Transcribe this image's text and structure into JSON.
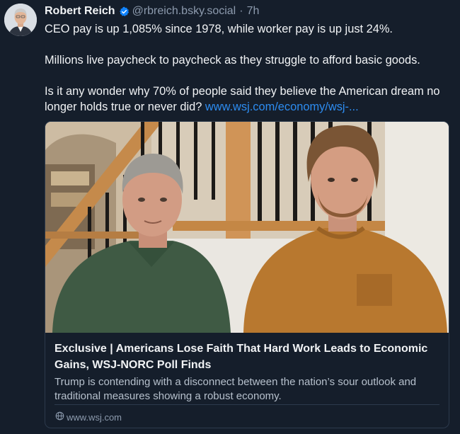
{
  "author": {
    "display_name": "Robert Reich",
    "handle": "@rbreich.bsky.social",
    "separator": "·",
    "time": "7h",
    "verified": true
  },
  "post": {
    "paragraph_1": "CEO pay is up 1,085% since 1978, while worker pay is up just 24%.",
    "paragraph_2": "Millions live paycheck to paycheck as they struggle to afford basic goods.",
    "paragraph_3_text": "Is it any wonder why 70% of people said they believe the American dream no longer holds true or never did? ",
    "paragraph_3_link": "www.wsj.com/economy/wsj-..."
  },
  "link_card": {
    "title": "Exclusive | Americans Lose Faith That Hard Work Leads to Economic Gains, WSJ-NORC Poll Finds",
    "description": "Trump is contending with a disconnect between the nation’s sour outlook and traditional measures showing a robust economy.",
    "domain": "www.wsj.com"
  },
  "colors": {
    "background": "#151e2b",
    "text": "#f1f3f5",
    "muted": "#8d9bae",
    "link": "#2d8cf0",
    "verified_badge": "#1083fe",
    "border": "#2c3a4c"
  },
  "icons": {
    "verified": "verified-check-icon",
    "domain": "globe-icon"
  }
}
